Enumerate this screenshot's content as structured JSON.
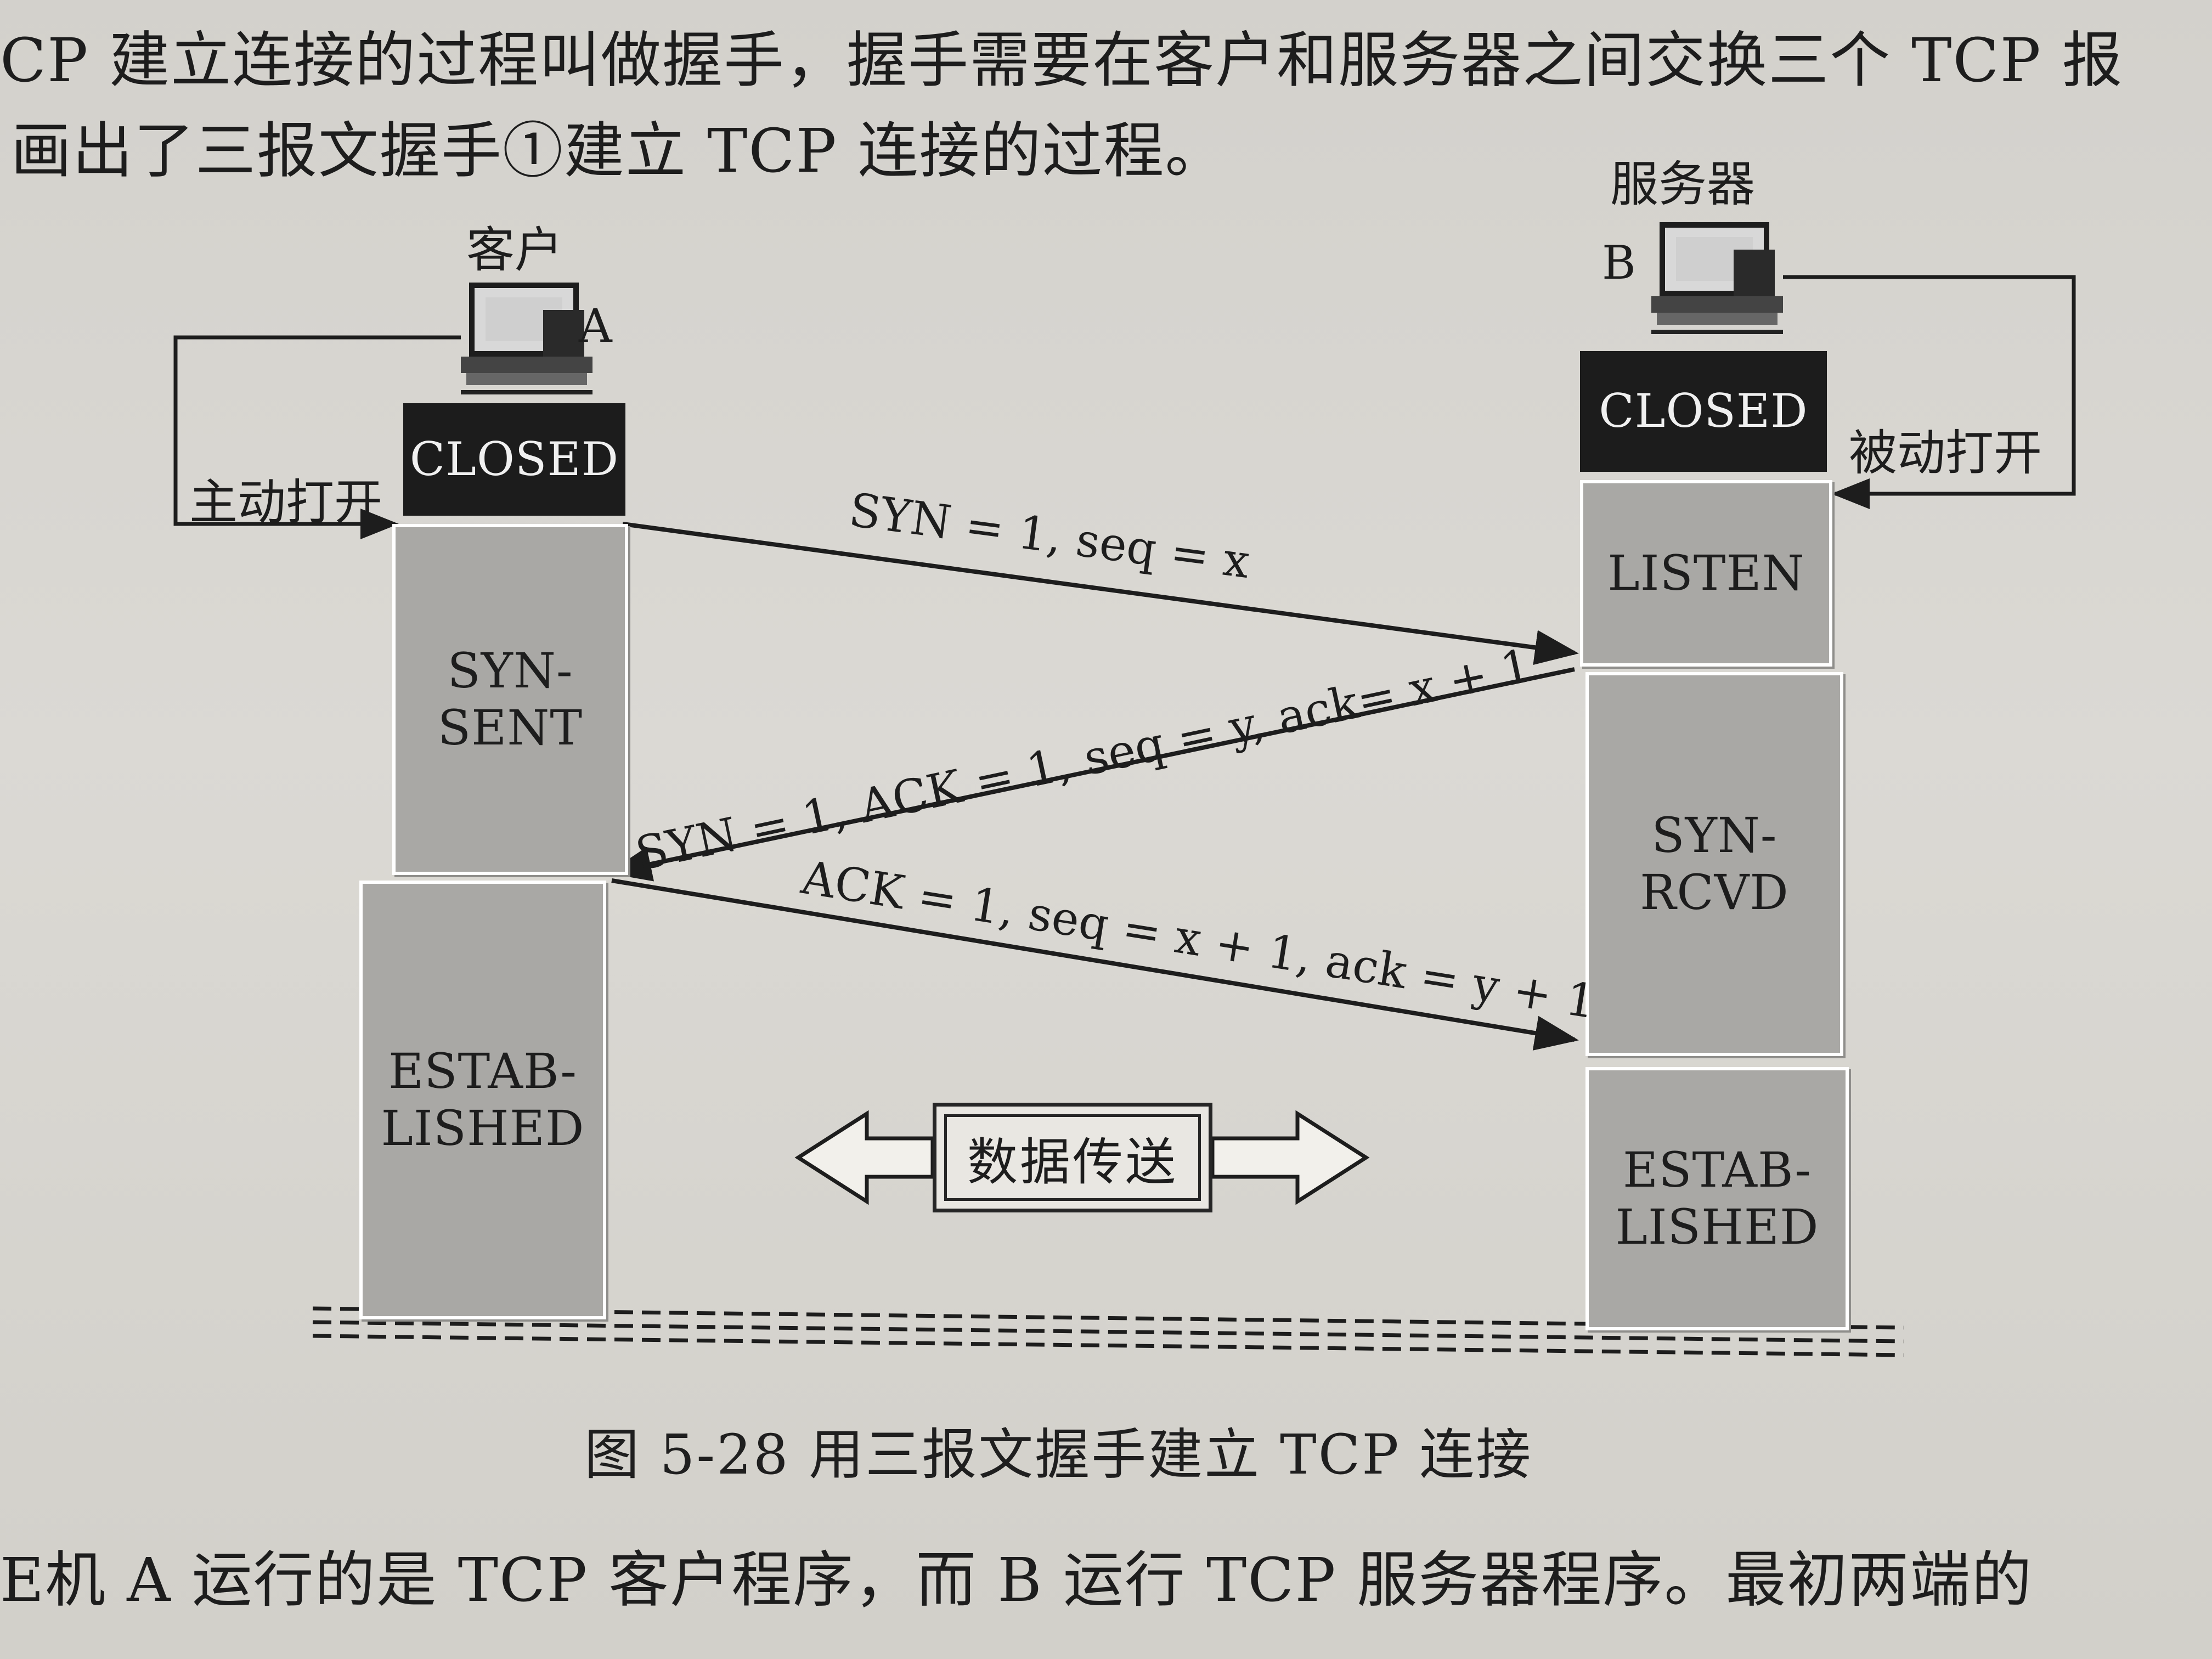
{
  "page": {
    "top_line_1": "CP 建立连接的过程叫做握手，握手需要在客户和服务器之间交换三个 TCP 报",
    "top_line_2": "画出了三报文握手①建立 TCP 连接的过程。",
    "top_right_fragment": "TCP 报",
    "bottom_line": "E机 A 运行的是 TCP 客户程序，而 B 运行 TCP 服务器程序。最初两端的"
  },
  "figure": {
    "caption": "图 5-28  用三报文握手建立 TCP 连接",
    "client": {
      "label": "客户",
      "letter": "A",
      "open_label": "主动打开",
      "states": [
        "CLOSED",
        "SYN-\nSENT",
        "ESTAB-\nLISHED"
      ]
    },
    "server": {
      "label": "服务器",
      "letter": "B",
      "open_label": "被动打开",
      "states": [
        "CLOSED",
        "LISTEN",
        "SYN-\nRCVD",
        "ESTAB-\nLISHED"
      ]
    },
    "messages": [
      {
        "text": "SYN = 1, seq = x",
        "direction": "client-to-server"
      },
      {
        "text": "SYN = 1, ACK = 1, seq = y, ack= x + 1",
        "direction": "server-to-client"
      },
      {
        "text": "ACK = 1, seq = x + 1, ack = y + 1",
        "direction": "client-to-server"
      }
    ],
    "data_transfer_label": "数据传送",
    "icons": [
      "computer-icon-client",
      "computer-icon-server",
      "double-arrow-icon"
    ]
  }
}
